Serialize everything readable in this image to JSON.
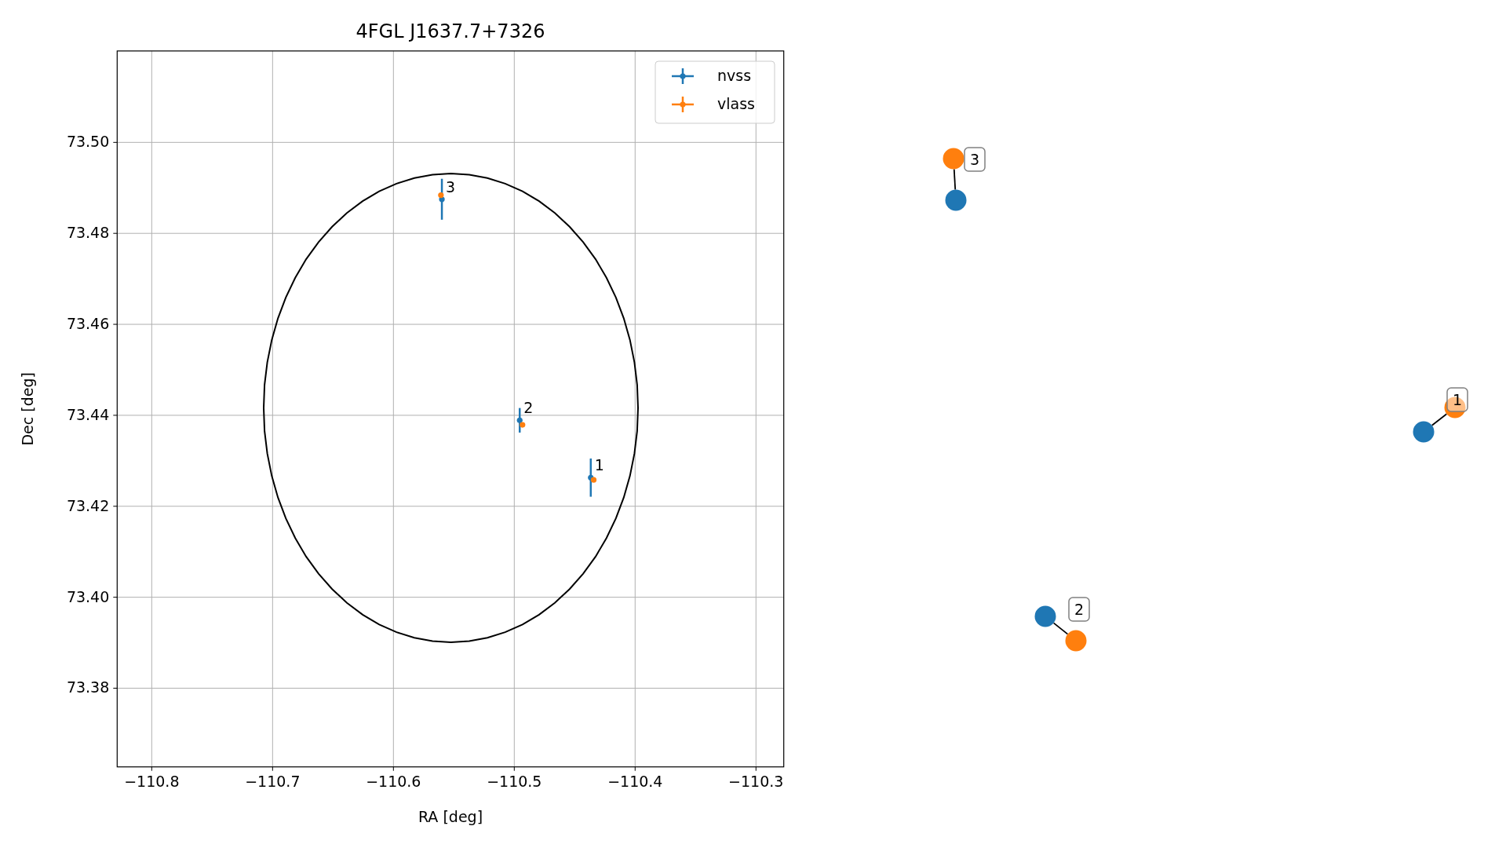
{
  "figure": {
    "chart_data": {
      "type": "scatter",
      "title": "4FGL J1637.7+7326",
      "xlabel": "RA [deg]",
      "ylabel": "Dec [deg]",
      "xlim": [
        -110.8286,
        -110.277
      ],
      "ylim": [
        73.3627,
        73.5201
      ],
      "grid": true,
      "legend": "upper right",
      "xticks": [
        {
          "value": -110.8,
          "label": "−110.8"
        },
        {
          "value": -110.7,
          "label": "−110.7"
        },
        {
          "value": -110.6,
          "label": "−110.6"
        },
        {
          "value": -110.5,
          "label": "−110.5"
        },
        {
          "value": -110.4,
          "label": "−110.4"
        },
        {
          "value": -110.3,
          "label": "−110.3"
        }
      ],
      "yticks": [
        {
          "value": 73.38,
          "label": "73.38"
        },
        {
          "value": 73.4,
          "label": "73.40"
        },
        {
          "value": 73.42,
          "label": "73.42"
        },
        {
          "value": 73.44,
          "label": "73.44"
        },
        {
          "value": 73.46,
          "label": "73.46"
        },
        {
          "value": 73.48,
          "label": "73.48"
        },
        {
          "value": 73.5,
          "label": "73.50"
        }
      ],
      "series": [
        {
          "name": "nvss",
          "color": "#1f77b4",
          "x": [
            -110.4367,
            -110.4955,
            -110.5599
          ],
          "values": [
            73.4263,
            73.4389,
            73.4875
          ],
          "errors": [
            0.0042,
            0.0027,
            0.0045
          ]
        },
        {
          "name": "vlass",
          "color": "#ff7f0e",
          "x": [
            -110.4343,
            -110.4932,
            -110.5607
          ],
          "values": [
            73.4258,
            73.4379,
            73.4884
          ],
          "errors": [
            0.0005,
            0.0005,
            0.0005
          ]
        }
      ],
      "annotations": [
        {
          "text": "1",
          "x": -110.4367,
          "y": 73.4263
        },
        {
          "text": "2",
          "x": -110.4955,
          "y": 73.4389
        },
        {
          "text": "3",
          "x": -110.5599,
          "y": 73.4875
        }
      ]
    },
    "matches": [
      {
        "label": "3",
        "points": [
          {
            "color": "#ff7f0e"
          },
          {
            "color": "#1f77b4"
          }
        ]
      },
      {
        "label": "1",
        "points": [
          {
            "color": "#1f77b4"
          },
          {
            "color": "#ff7f0e"
          }
        ]
      },
      {
        "label": "2",
        "points": [
          {
            "color": "#1f77b4"
          },
          {
            "color": "#ff7f0e"
          }
        ]
      }
    ]
  }
}
